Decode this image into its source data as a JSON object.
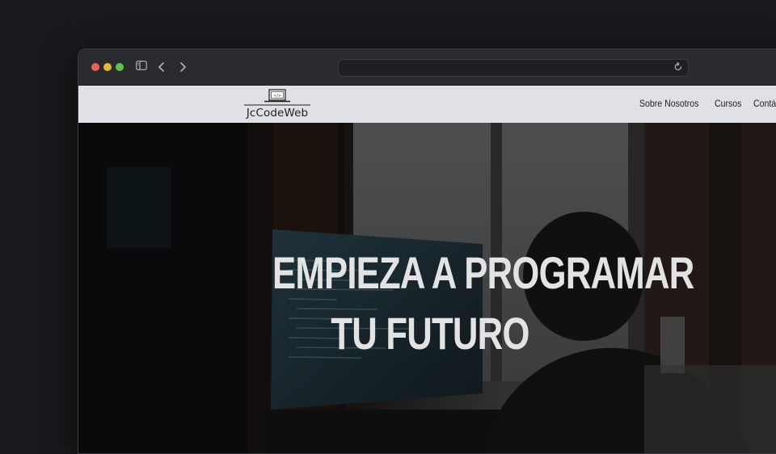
{
  "browser": {
    "url": "",
    "controls": [
      "close",
      "minimize",
      "zoom"
    ],
    "icons": [
      "sidebar-icon",
      "back-icon",
      "forward-icon",
      "reload-icon"
    ]
  },
  "site": {
    "logo_text": "JcCodeWeb",
    "nav": [
      "Sobre Nosotros",
      "Cursos",
      "Contáctanos"
    ]
  },
  "hero": {
    "title_line1": "EMPIEZA A PROGRAMAR",
    "title_line2": "TU FUTURO"
  },
  "colors": {
    "navbar_bg": "#dfe1e7",
    "titlebar_bg": "#2a2b2e",
    "hero_text": "#e3e3e3"
  }
}
